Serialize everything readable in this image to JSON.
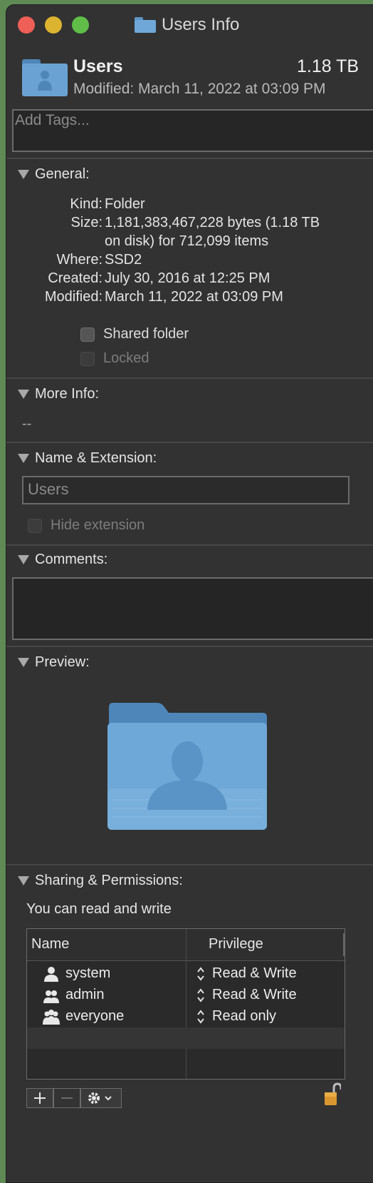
{
  "window": {
    "title": "Users Info"
  },
  "header": {
    "name": "Users",
    "size": "1.18 TB",
    "modified": "Modified: March 11, 2022 at 03:09 PM"
  },
  "tags": {
    "placeholder": "Add Tags..."
  },
  "general": {
    "heading": "General:",
    "kind_label": "Kind:",
    "kind": "Folder",
    "size_label": "Size:",
    "size_line1": "1,181,383,467,228 bytes (1.18 TB",
    "size_line2": "on disk) for 712,099 items",
    "where_label": "Where:",
    "where": "SSD2",
    "created_label": "Created:",
    "created": "July 30, 2016 at 12:25 PM",
    "modified_label": "Modified:",
    "modified": "March 11, 2022 at 03:09 PM",
    "shared_folder": "Shared folder",
    "locked": "Locked"
  },
  "more_info": {
    "heading": "More Info:",
    "value": "--"
  },
  "name_ext": {
    "heading": "Name & Extension:",
    "name_value": "Users",
    "hide_extension": "Hide extension"
  },
  "comments": {
    "heading": "Comments:"
  },
  "preview": {
    "heading": "Preview:"
  },
  "sharing": {
    "heading": "Sharing & Permissions:",
    "status": "You can read and write",
    "col_name": "Name",
    "col_privilege": "Privilege",
    "rows": [
      {
        "name": "system",
        "privilege": "Read & Write",
        "icon": "single-user-icon"
      },
      {
        "name": "admin",
        "privilege": "Read & Write",
        "icon": "group-icon"
      },
      {
        "name": "everyone",
        "privilege": "Read only",
        "icon": "everyone-icon"
      }
    ]
  },
  "colors": {
    "folder": "#6aa3d3",
    "close": "#ee5f57",
    "minimize": "#ddb42f",
    "maximize": "#5fbd48"
  }
}
